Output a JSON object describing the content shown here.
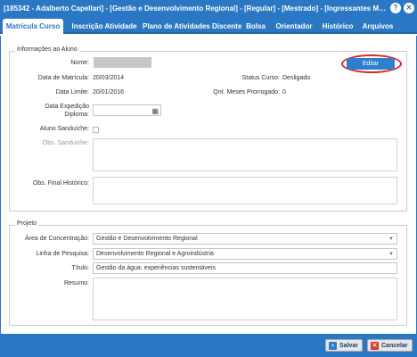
{
  "window": {
    "title": "[185342 - Adalberto Capellari] - [Gestão e Desenvolvimento Regional] - [Regular] - [Mestrado] - [Ingressantes Mestrado Re...",
    "help_glyph": "?",
    "close_glyph": "✕"
  },
  "tabs": [
    {
      "label": "Matrícula Curso"
    },
    {
      "label": "Inscrição Atividade"
    },
    {
      "label": "Plano de Atividades Discente"
    },
    {
      "label": "Bolsa"
    },
    {
      "label": "Orientador"
    },
    {
      "label": "Histórico"
    },
    {
      "label": "Arquivos"
    }
  ],
  "aluno": {
    "legend": "Informações ao Aluno",
    "nome_label": "Nome:",
    "editar_label": "Editar",
    "data_matricula_label": "Data de Matrícula:",
    "data_matricula": "20/03/2014",
    "status_label": "Status Curso:",
    "status": "Desligado",
    "data_limite_label": "Data Limite:",
    "data_limite": "20/01/2016",
    "meses_label": "Qnt. Meses Prorrogado:",
    "meses": "0",
    "data_expedicao_label_1": "Data Expedição",
    "data_expedicao_label_2": "Diploma:",
    "sanduiche_label": "Aluno Sanduíche:",
    "obs_sanduiche_label": "Obs. Sanduíche:",
    "obs_final_label": "Obs. Final Histórico:"
  },
  "projeto": {
    "legend": "Projeto",
    "area_label": "Área de Concentração:",
    "area_value": "Gestão e Desenvolvimento Regional",
    "linha_label": "Linha de Pesquisa:",
    "linha_value": "Desenvolvimento Regional e Agroindústria",
    "titulo_label": "Título:",
    "titulo_value": "Gestão da água: experiências sustentáveis",
    "resumo_label": "Resumo:"
  },
  "footer": {
    "salvar_label": "Salvar",
    "cancelar_label": "Cancelar"
  },
  "colors": {
    "primary": "#2a78c4",
    "highlight_ellipse": "#d8262b",
    "save_icon": "#2f7fcf",
    "cancel_icon": "#d83a2b"
  }
}
